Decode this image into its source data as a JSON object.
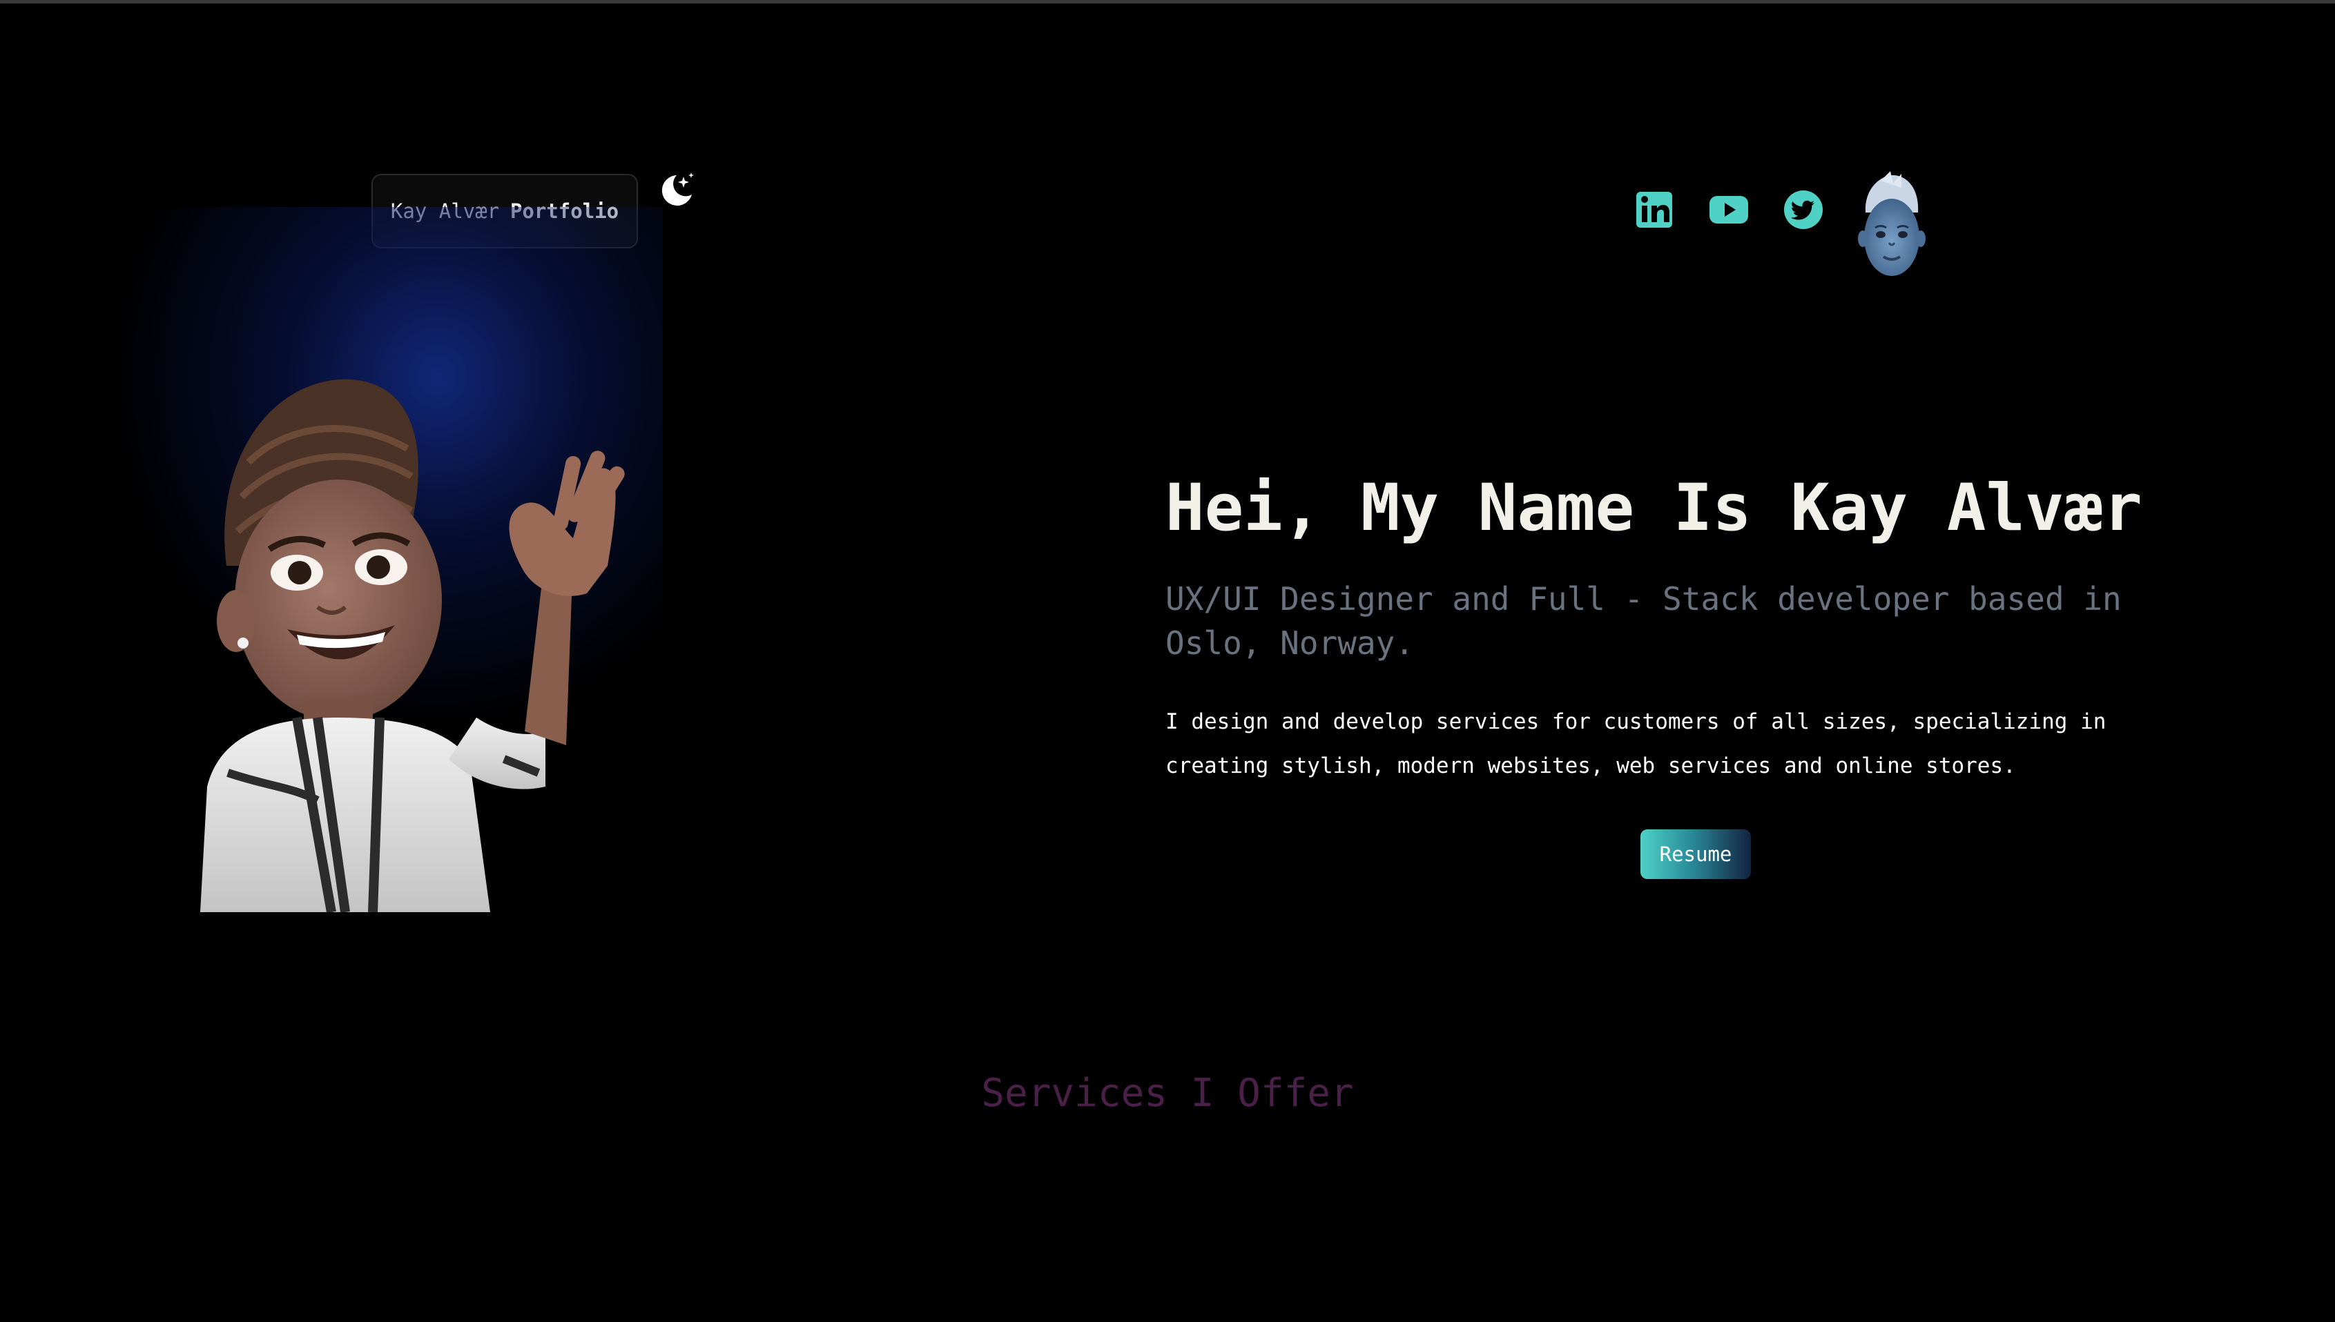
{
  "header": {
    "brand_name": "Kay Alvær",
    "brand_suffix": "Portfolio",
    "theme_toggle_icon": "moon-stars-icon",
    "social_links": [
      {
        "name": "LinkedIn",
        "icon": "linkedin-icon"
      },
      {
        "name": "YouTube",
        "icon": "youtube-icon"
      },
      {
        "name": "Twitter",
        "icon": "twitter-icon"
      }
    ],
    "avatar_icon": "avatar-memoji"
  },
  "hero": {
    "title": "Hei, My Name Is Kay Alvær",
    "subtitle": "UX/UI Designer and Full - Stack developer based in Oslo, Norway.",
    "description": "I design and develop services for customers of all sizes, specializing in creating stylish, modern websites, web services and online stores.",
    "resume_label": "Resume",
    "illustration": "waving-memoji"
  },
  "services": {
    "heading": "Services I Offer"
  },
  "colors": {
    "background": "#000000",
    "accent_teal": "#4fd1c5",
    "title": "#f1f1ea",
    "subtitle": "#6a7280",
    "services_heading": "#4a1f48",
    "glow_blue": "#142d8c"
  }
}
